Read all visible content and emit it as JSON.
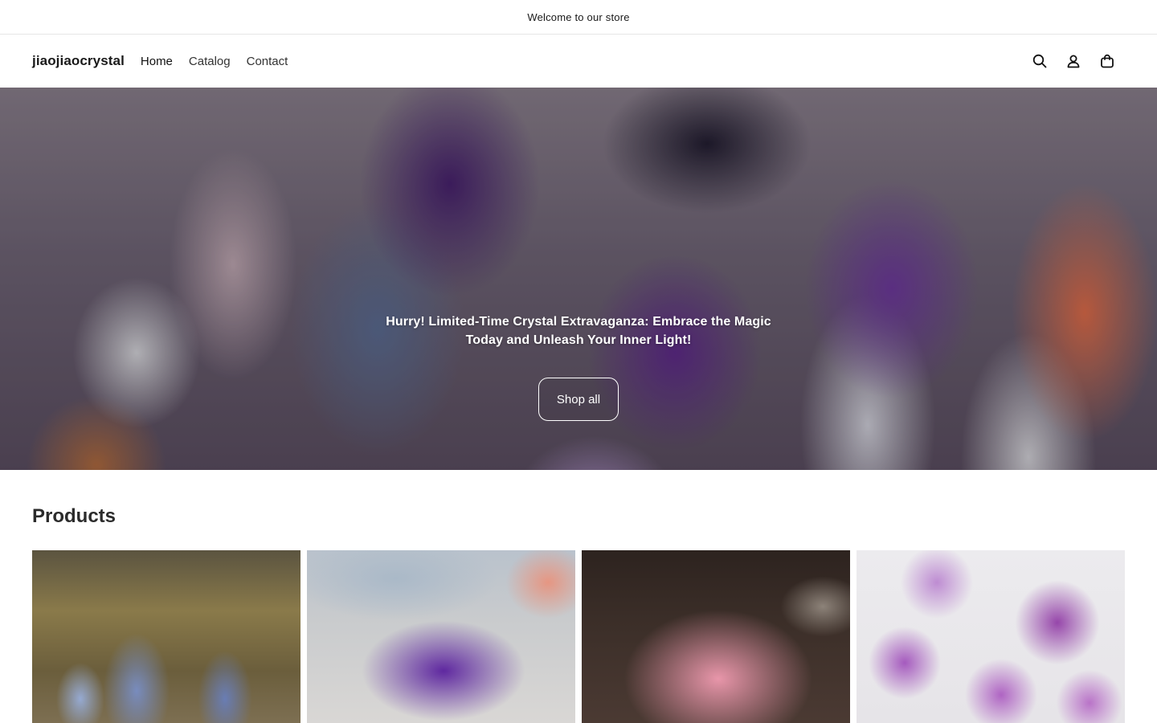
{
  "announcement": {
    "text": "Welcome to our store"
  },
  "header": {
    "logo": "jiaojiaocrystal",
    "nav": [
      {
        "label": "Home"
      },
      {
        "label": "Catalog"
      },
      {
        "label": "Contact"
      }
    ],
    "icons": [
      "search-icon",
      "account-icon",
      "cart-icon"
    ]
  },
  "hero": {
    "heading": "Hurry! Limited-Time Crystal Extravaganza: Embrace the Magic Today and Unleash Your Inner Light!",
    "button_label": "Shop all"
  },
  "products": {
    "title": "Products",
    "items": [
      {
        "image": "agate-geode-towers-photo"
      },
      {
        "image": "amethyst-bead-bracelets-photo"
      },
      {
        "image": "rose-quartz-towers-photo"
      },
      {
        "image": "amethyst-points-photo"
      }
    ]
  }
}
